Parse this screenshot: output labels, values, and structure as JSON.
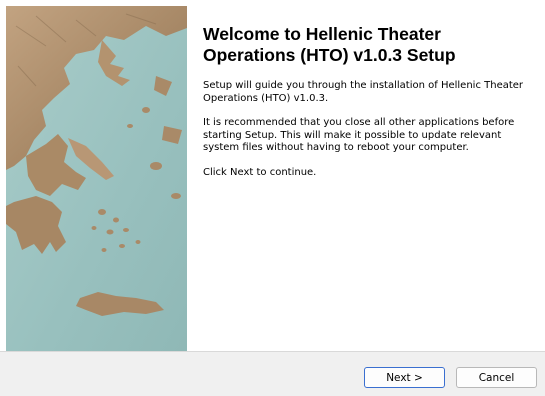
{
  "wizard": {
    "title": "Welcome to Hellenic Theater Operations (HTO) v1.0.3 Setup",
    "paragraphs": [
      "Setup will guide you through the installation of Hellenic Theater Operations (HTO) v1.0.3.",
      "It is recommended that you close all other applications before starting Setup. This will make it possible to update relevant system files without having to reboot your computer.",
      "Click Next to continue."
    ]
  },
  "buttons": {
    "next_label": "Next >",
    "cancel_label": "Cancel"
  },
  "colors": {
    "sea": "#9fc4c2",
    "land": "#b99a78",
    "accent_focus": "#3a6fd0"
  },
  "icons": {
    "side_image": "greece-relief-map"
  }
}
